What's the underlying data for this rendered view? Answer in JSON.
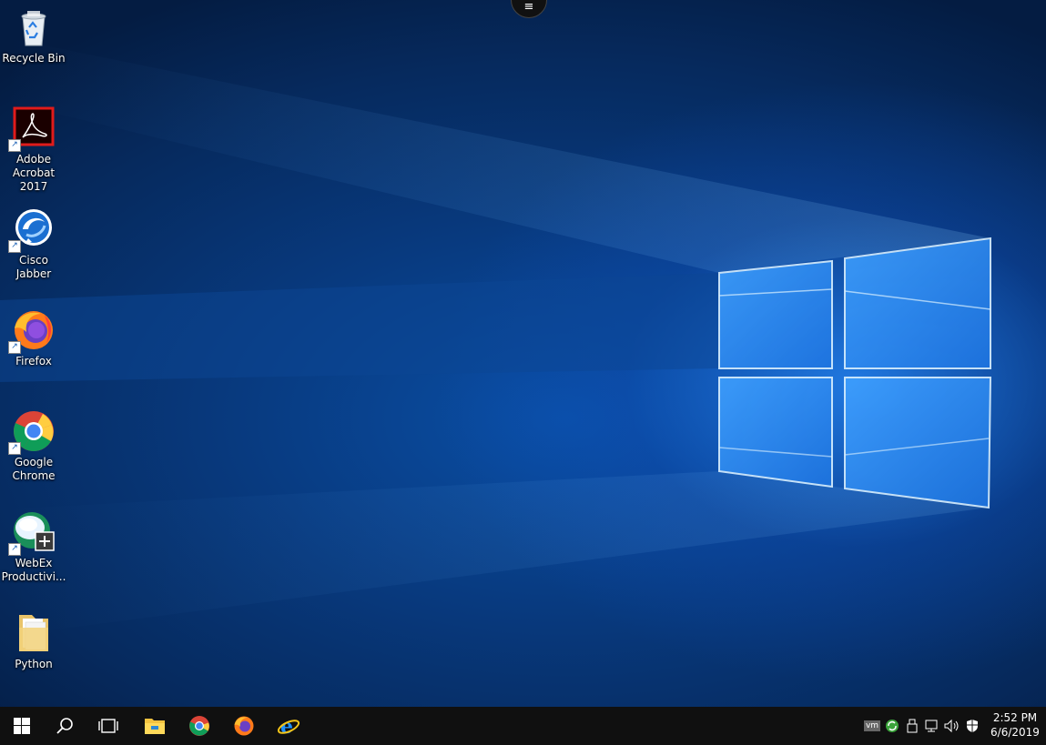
{
  "desktop": {
    "icons": [
      {
        "label": "Recycle Bin",
        "icon": "recycle-bin-icon",
        "shortcut": false
      },
      {
        "label": "Adobe Acrobat 2017",
        "icon": "adobe-acrobat-icon",
        "shortcut": true
      },
      {
        "label": "Cisco Jabber",
        "icon": "cisco-jabber-icon",
        "shortcut": true
      },
      {
        "label": "Firefox",
        "icon": "firefox-icon",
        "shortcut": true
      },
      {
        "label": "Google Chrome",
        "icon": "chrome-icon",
        "shortcut": true
      },
      {
        "label": "WebEx Productivi...",
        "icon": "webex-icon",
        "shortcut": true
      },
      {
        "label": "Python",
        "icon": "folder-icon",
        "shortcut": false
      }
    ],
    "top_menu_glyph": "≡"
  },
  "taskbar": {
    "pinned": [
      "start-icon",
      "search-icon",
      "task-view-icon",
      "file-explorer-icon",
      "chrome-icon",
      "firefox-icon",
      "internet-explorer-icon"
    ],
    "tray_icons": [
      "vmware-icon",
      "sync-icon",
      "usb-icon",
      "network-icon",
      "volume-icon",
      "defender-icon"
    ],
    "tray_vm_text": "vm",
    "clock": {
      "time": "2:52 PM",
      "date": "6/6/2019"
    }
  },
  "colors": {
    "taskbar": "#101010",
    "wallpaper": "#083a7f"
  }
}
